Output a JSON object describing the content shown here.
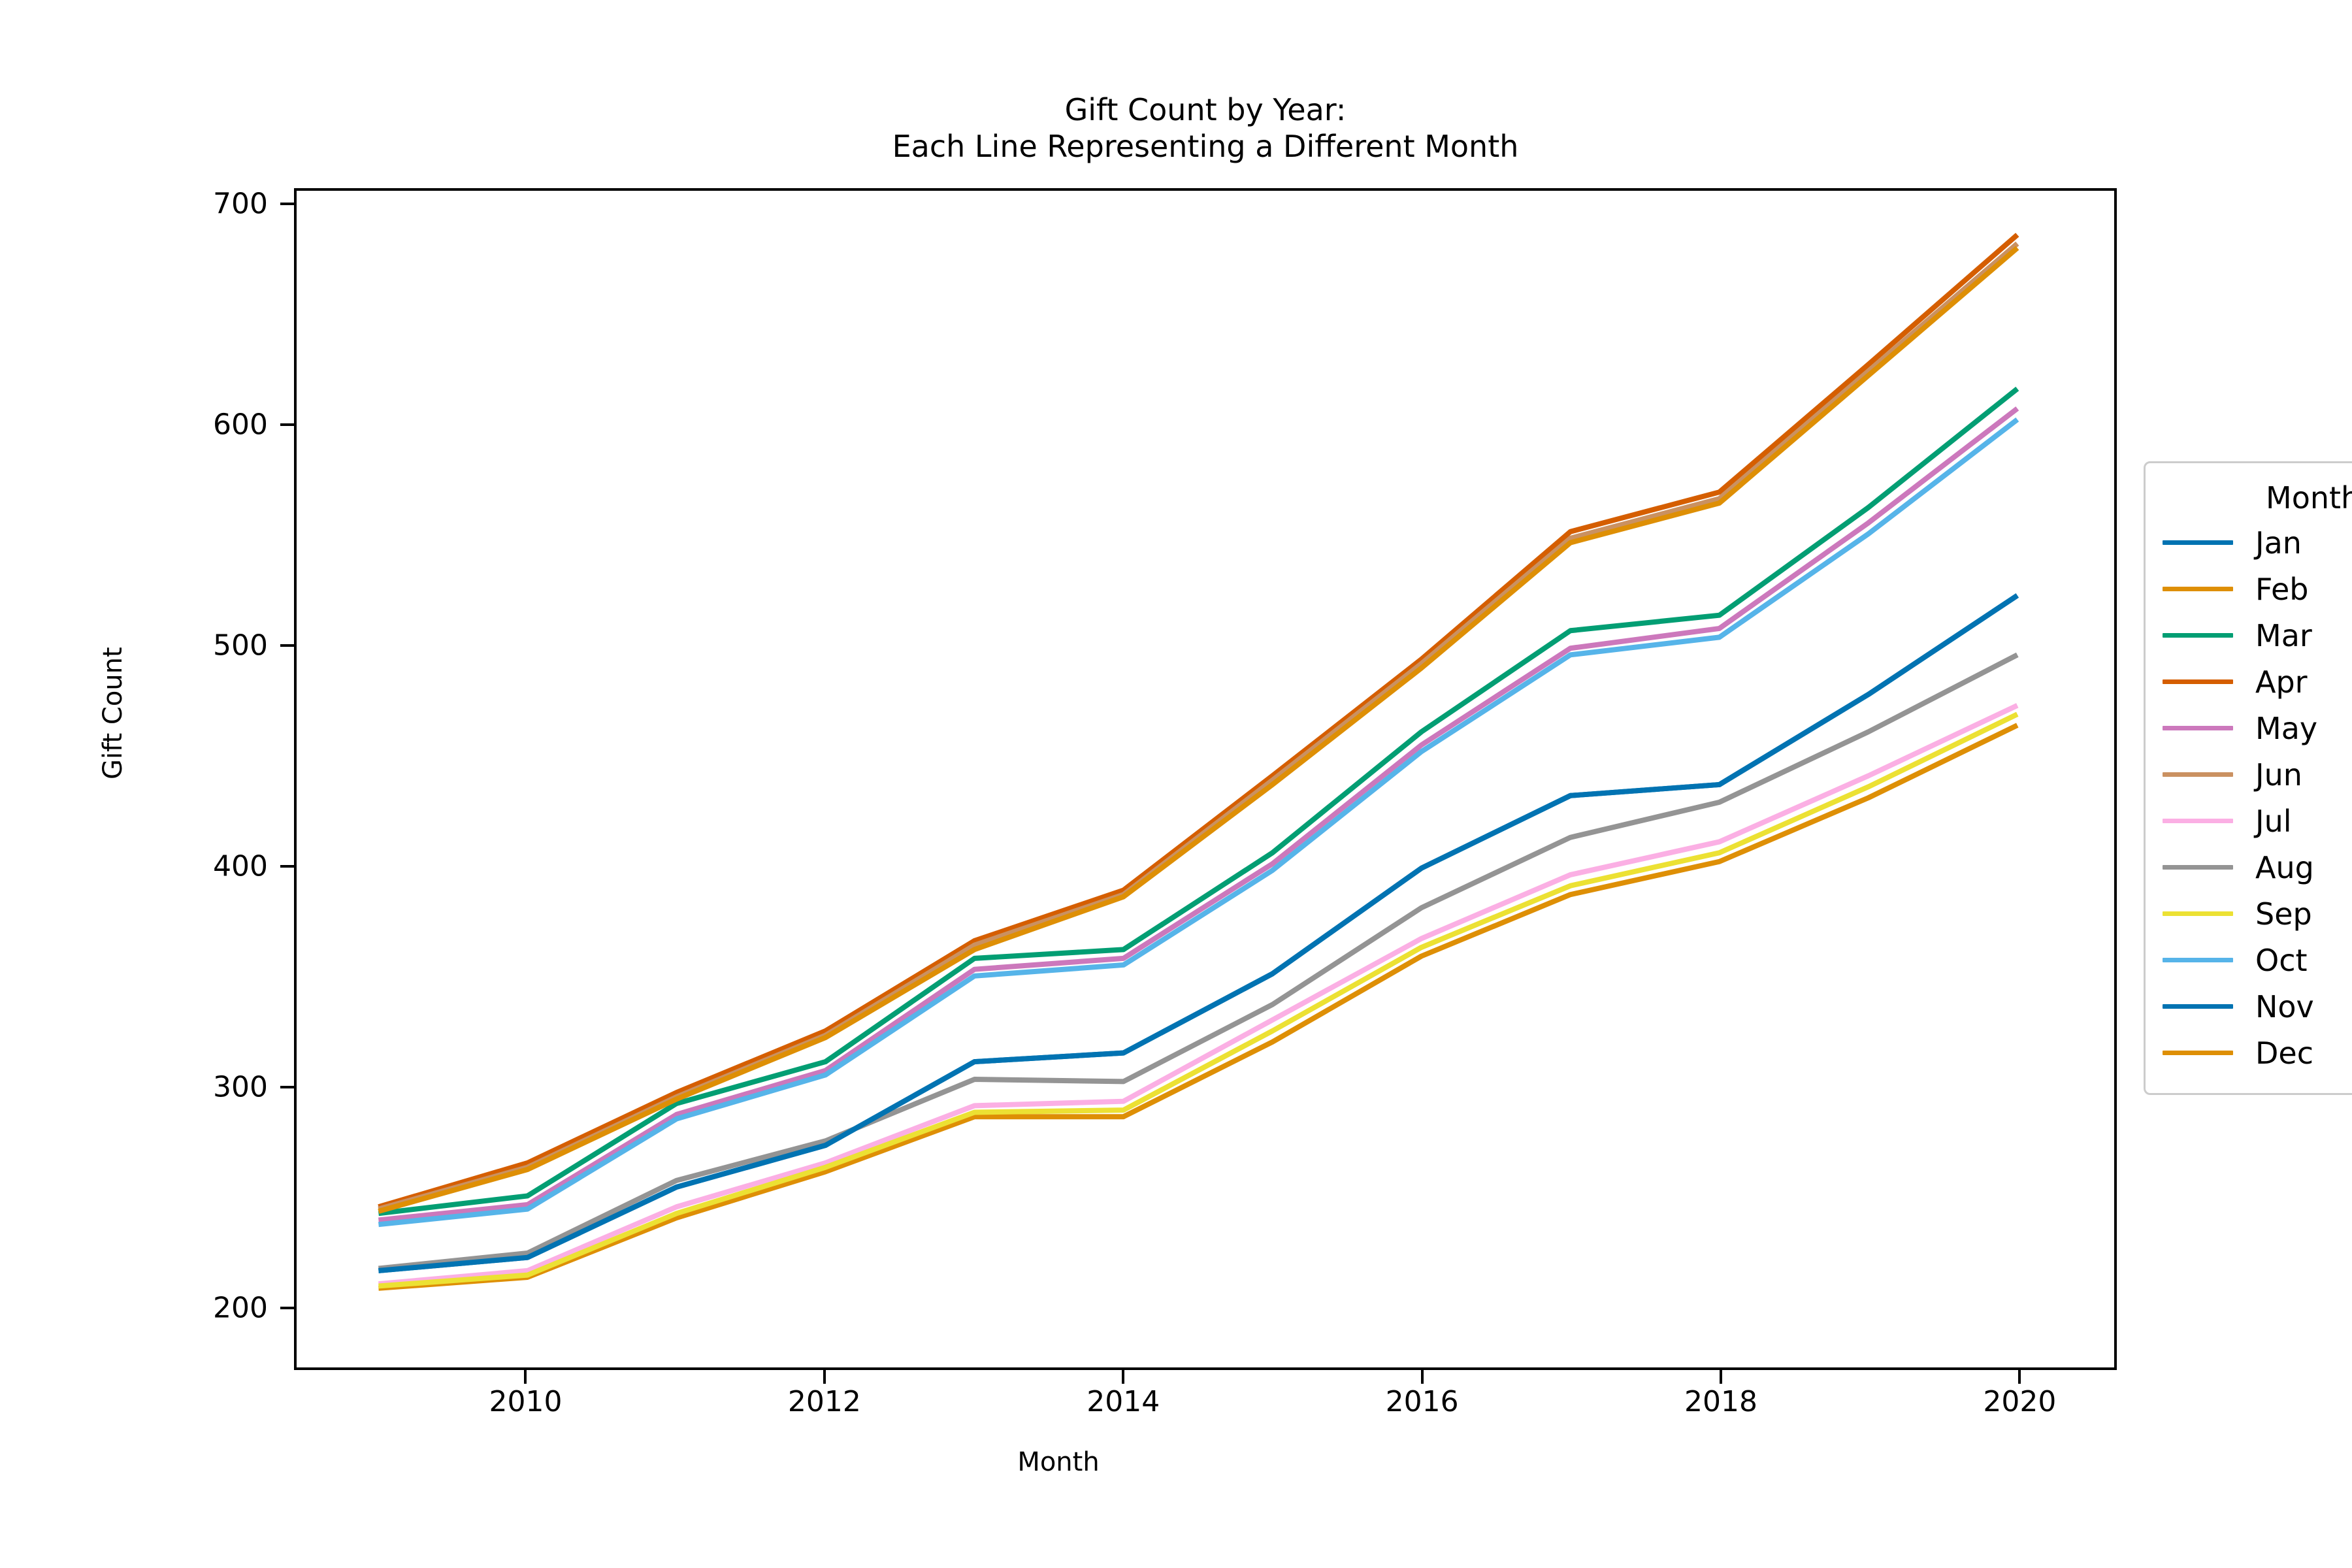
{
  "chart_data": {
    "type": "line",
    "title": "Gift Count by Year:\nEach Line Representing a Different Month",
    "title_line1": "Gift Count by Year:",
    "title_line2": "Each Line Representing a Different Month",
    "xlabel": "Month",
    "ylabel": "Gift Count",
    "legend_title": "Month_",
    "legend_position": "right outside",
    "grid": false,
    "xlim": [
      2008.45,
      2020.65
    ],
    "ylim": [
      172,
      707
    ],
    "xticks": [
      2010,
      2012,
      2014,
      2016,
      2018,
      2020
    ],
    "xtick_labels": [
      "2010",
      "2012",
      "2014",
      "2016",
      "2018",
      "2020"
    ],
    "yticks": [
      200,
      300,
      400,
      500,
      600,
      700
    ],
    "ytick_labels": [
      "200",
      "300",
      "400",
      "500",
      "600",
      "700"
    ],
    "x": [
      2009,
      2010,
      2011,
      2012,
      2013,
      2014,
      2015,
      2016,
      2017,
      2018,
      2019,
      2020
    ],
    "series": [
      {
        "name": "Jan",
        "color": "#0173B2",
        "values": [
          216,
          222,
          254,
          273,
          311,
          315,
          351,
          399,
          432,
          437,
          478,
          523
        ]
      },
      {
        "name": "Feb",
        "color": "#DE8F05",
        "values": [
          208,
          213,
          240,
          261,
          286,
          286,
          320,
          359,
          387,
          402,
          431,
          464
        ]
      },
      {
        "name": "Mar",
        "color": "#029E73",
        "values": [
          242,
          250,
          292,
          311,
          358,
          362,
          406,
          461,
          507,
          514,
          563,
          617
        ]
      },
      {
        "name": "Apr",
        "color": "#D55E00",
        "values": [
          245,
          265,
          297,
          325,
          366,
          389,
          441,
          494,
          552,
          570,
          628,
          687
        ]
      },
      {
        "name": "May",
        "color": "#CC78BC",
        "values": [
          239,
          246,
          287,
          307,
          353,
          358,
          401,
          455,
          499,
          508,
          556,
          608
        ]
      },
      {
        "name": "Jun",
        "color": "#CA9161",
        "values": [
          244,
          263,
          295,
          323,
          364,
          387,
          439,
          492,
          549,
          567,
          625,
          683
        ]
      },
      {
        "name": "Jul",
        "color": "#FBAFE4",
        "values": [
          210,
          216,
          245,
          265,
          291,
          293,
          330,
          367,
          396,
          411,
          441,
          473
        ]
      },
      {
        "name": "Aug",
        "color": "#949494",
        "values": [
          217,
          224,
          257,
          275,
          303,
          302,
          337,
          381,
          413,
          429,
          461,
          496
        ]
      },
      {
        "name": "Sep",
        "color": "#ECE133",
        "values": [
          209,
          214,
          242,
          263,
          288,
          289,
          325,
          363,
          391,
          406,
          436,
          469
        ]
      },
      {
        "name": "Oct",
        "color": "#56B4E9",
        "values": [
          237,
          244,
          285,
          305,
          350,
          355,
          398,
          452,
          496,
          504,
          551,
          603
        ]
      },
      {
        "name": "Nov",
        "color": "#0173B2",
        "values": [
          216,
          222,
          254,
          273,
          311,
          315,
          351,
          399,
          432,
          437,
          478,
          523
        ]
      },
      {
        "name": "Dec",
        "color": "#DE8F05",
        "values": [
          243,
          262,
          294,
          322,
          362,
          386,
          437,
          490,
          547,
          565,
          623,
          681
        ]
      }
    ]
  },
  "legend": {
    "title": "Month_",
    "entries": [
      {
        "label": "Jan"
      },
      {
        "label": "Feb"
      },
      {
        "label": "Mar"
      },
      {
        "label": "Apr"
      },
      {
        "label": "May"
      },
      {
        "label": "Jun"
      },
      {
        "label": "Jul"
      },
      {
        "label": "Aug"
      },
      {
        "label": "Sep"
      },
      {
        "label": "Oct"
      },
      {
        "label": "Nov"
      },
      {
        "label": "Dec"
      }
    ]
  }
}
